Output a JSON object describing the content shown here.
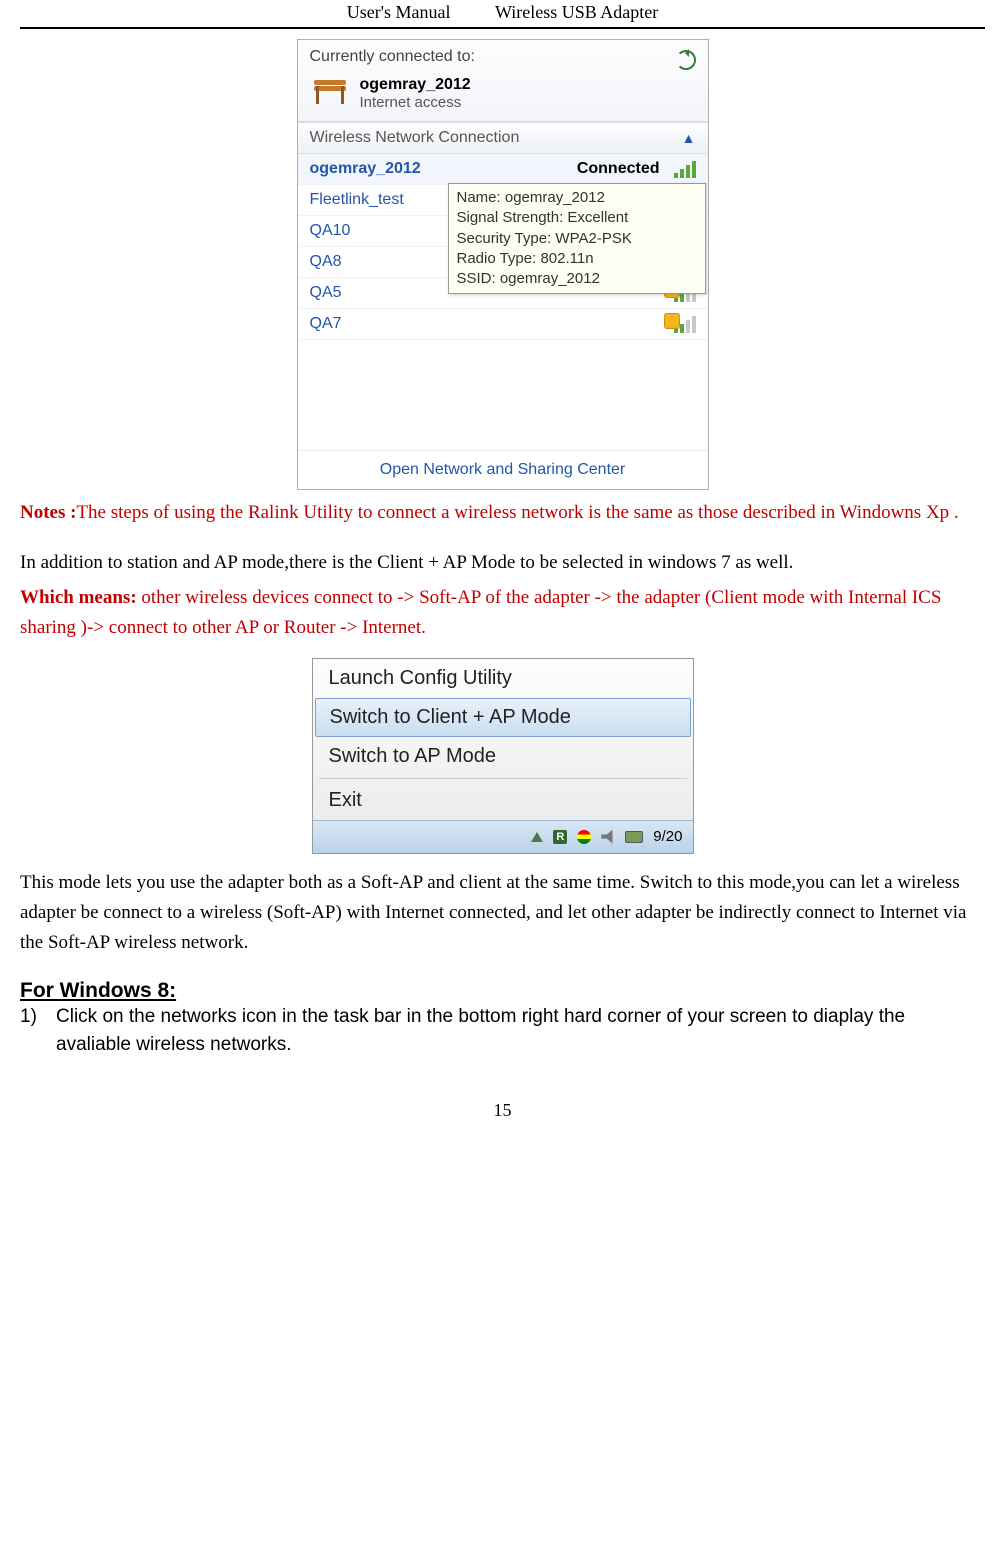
{
  "header": {
    "left": "User's Manual",
    "right": "Wireless USB Adapter"
  },
  "wifiPanel": {
    "title": "Currently connected to:",
    "network": "ogemray_2012",
    "subtitle": "Internet access",
    "sectionHeader": "Wireless Network Connection",
    "items": [
      {
        "name": "ogemray_2012",
        "status": "Connected"
      },
      {
        "name": "Fleetlink_test"
      },
      {
        "name": "QA10"
      },
      {
        "name": "QA8"
      },
      {
        "name": "QA5"
      },
      {
        "name": "QA7"
      }
    ],
    "tooltip": {
      "l1": "Name: ogemray_2012",
      "l2": "Signal Strength: Excellent",
      "l3": "Security Type: WPA2-PSK",
      "l4": "Radio Type: 802.11n",
      "l5": "SSID: ogemray_2012"
    },
    "bottomLink": "Open Network and Sharing Center"
  },
  "notesLabel": "Notes :",
  "notesText": "The steps of using the Ralink Utility to connect a wireless network is the same as those described in Windowns Xp .",
  "para2": "In addition to station and AP mode,there is the Client + AP Mode to be selected in windows 7 as well.",
  "whichLabel": "Which means:",
  "whichText": " other wireless devices connect    to -> Soft-AP of the adapter -> the adapter (Client mode with Internal ICS sharing )-> connect to other AP or Router -> Internet.",
  "menu": {
    "i1": "Launch Config Utility",
    "i2": "Switch to Client + AP Mode",
    "i3": "Switch to AP Mode",
    "i4": "Exit",
    "time": "9/20"
  },
  "para3": "This mode lets you use the adapter both as a Soft-AP and client   at the same time. Switch to this mode,you can let a wireless adapter be connect to a wireless (Soft-AP) with Internet connected, and let other adapter be indirectly connect to Internet via the Soft-AP wireless network.",
  "win8Heading": "For Windows 8:",
  "win8Item1Num": "1)",
  "win8Item1": "Click on the networks icon in the task bar in the bottom right hard corner of your screen to diaplay the avaliable wireless networks.",
  "pageNumber": "15"
}
